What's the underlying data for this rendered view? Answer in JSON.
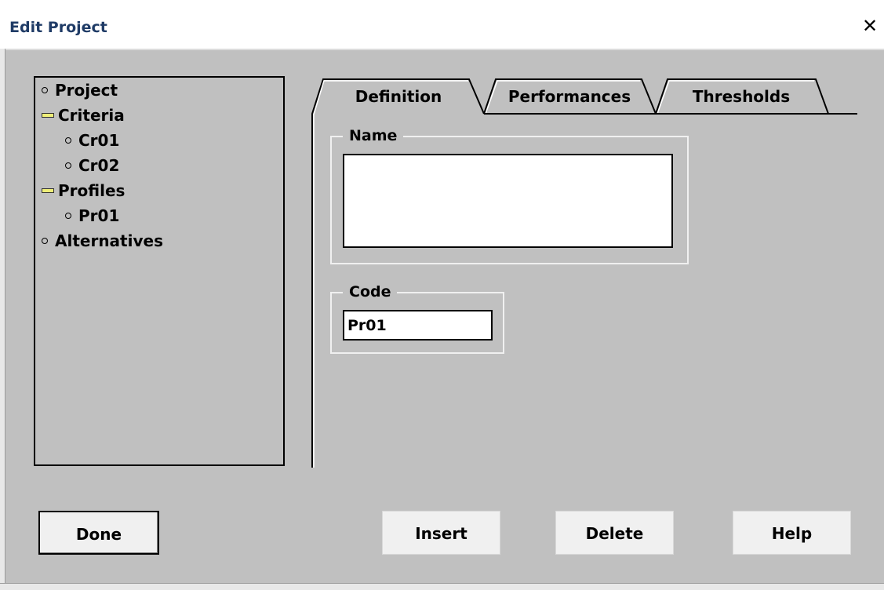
{
  "window": {
    "title": "Edit Project",
    "close_label": "✕"
  },
  "tree": {
    "items": [
      {
        "label": "Project",
        "marker": "dot",
        "level": 0
      },
      {
        "label": "Criteria",
        "marker": "dash",
        "level": 0
      },
      {
        "label": "Cr01",
        "marker": "dot",
        "level": 1
      },
      {
        "label": "Cr02",
        "marker": "dot",
        "level": 1
      },
      {
        "label": "Profiles",
        "marker": "dash",
        "level": 0
      },
      {
        "label": "Pr01",
        "marker": "dot",
        "level": 1
      },
      {
        "label": "Alternatives",
        "marker": "dot",
        "level": 0
      }
    ]
  },
  "tabs": [
    {
      "label": "Definition",
      "active": true
    },
    {
      "label": "Performances",
      "active": false
    },
    {
      "label": "Thresholds",
      "active": false
    }
  ],
  "form": {
    "name_label": "Name",
    "name_value": "",
    "code_label": "Code",
    "code_value": "Pr01"
  },
  "buttons": {
    "done": "Done",
    "insert": "Insert",
    "delete": "Delete",
    "help": "Help"
  }
}
